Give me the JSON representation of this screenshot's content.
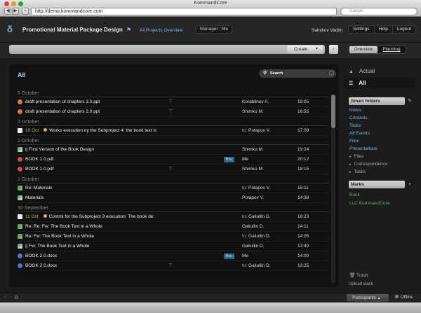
{
  "window": {
    "title": "KommandCore",
    "url": "http://demo.kommandcore.com",
    "google_placeholder": "Google"
  },
  "header": {
    "project_title": "Promotional Material Package Design",
    "all_projects": "All Projects Overview",
    "manager_label": "Manager : Me",
    "user": "Salnikov Vadim",
    "menu": [
      "Settings",
      "Help",
      "Logout"
    ]
  },
  "toolbar": {
    "create_label": "Create",
    "views": [
      "Overview",
      "Planning"
    ]
  },
  "main": {
    "title": "All",
    "search_label": "Search",
    "groups": [
      {
        "date": "5 October",
        "rows": [
          {
            "icon": "ppt",
            "title": "draft presentation of chapters 3.0.ppt",
            "pin": true,
            "tag": "",
            "to": false,
            "who": "Korablinov A.",
            "time": "19:05"
          },
          {
            "icon": "ppt",
            "title": "draft presentation of chapters 2.0.ppt",
            "pin": true,
            "tag": "",
            "to": false,
            "who": "Shimko M.",
            "time": "16:55"
          }
        ]
      },
      {
        "date": "3 October",
        "rows": [
          {
            "icon": "chk",
            "task_date": "10 Oct",
            "title": "Works execution ny the Subproject 4: the book text is",
            "pin": false,
            "tag": "",
            "to": true,
            "who": "Potapov V.",
            "time": "17:09"
          }
        ]
      },
      {
        "date": "2 October",
        "rows": [
          {
            "icon": "mail2",
            "title": "|| First Version of the Book Design",
            "pin": false,
            "tag": "",
            "to": false,
            "who": "Shimko M.",
            "time": "19:24"
          },
          {
            "icon": "pdf",
            "title": "BOOK 1.0.pdf",
            "pin": false,
            "tag": "Box",
            "to": false,
            "who": "Me",
            "time": "20:12"
          },
          {
            "icon": "pdf",
            "title": "BOOK 1.0.pdf",
            "pin": true,
            "tag": "",
            "to": false,
            "who": "Shimko M.",
            "time": "18:15"
          }
        ]
      },
      {
        "date": "1 October",
        "rows": [
          {
            "icon": "mail",
            "title": "Re: Materials",
            "pin": false,
            "tag": "",
            "to": true,
            "who": "Potapov V.",
            "time": "15:11"
          },
          {
            "icon": "mail2",
            "title": "Materials",
            "pin": false,
            "tag": "",
            "to": false,
            "who": "Potapov V.",
            "time": "14:38"
          }
        ]
      },
      {
        "date": "30 September",
        "rows": [
          {
            "icon": "chk",
            "task_date": "11 Oct",
            "title": "Control for the Subproject 3 execution: The book de:",
            "pin": false,
            "tag": "",
            "to": true,
            "who": "Galiullin D.",
            "time": "16:23"
          },
          {
            "icon": "mail",
            "title": "Re: Re: Fw: The Book Text in a Whole",
            "pin": false,
            "tag": "",
            "to": false,
            "who": "Galiullin D.",
            "time": "14:11"
          },
          {
            "icon": "mail",
            "title": "Re: Fw: The Book Text in a Whole",
            "pin": false,
            "tag": "",
            "to": true,
            "who": "Galiullin D.",
            "time": "14:05"
          },
          {
            "icon": "mail2",
            "title": "|| Fw: The Book Text in a Whole",
            "pin": false,
            "tag": "",
            "to": false,
            "who": "Galiullin D.",
            "time": "13:40"
          },
          {
            "icon": "doc",
            "title": "BOOK 2.0.docx",
            "pin": false,
            "tag": "Box",
            "to": false,
            "who": "Me",
            "time": "14:00"
          },
          {
            "icon": "doc",
            "title": "BOOK 2.0.docx",
            "pin": true,
            "tag": "",
            "to": true,
            "who": "Galiullin D.",
            "time": "13:25"
          }
        ]
      }
    ],
    "to_label": "to:"
  },
  "sidebar": {
    "actual": "Actual",
    "all": "All",
    "smart_folders": "Smart folders",
    "smart_links": [
      "Notes",
      "Contacts",
      "Tasks",
      "All Events",
      "Files",
      "Presentations"
    ],
    "smart_sub": [
      "Files",
      "Correspondence",
      "Tasks"
    ],
    "marks": "Marks",
    "mark_links": [
      "Book",
      "LLC KommandCore"
    ],
    "trash": "Trash",
    "upload": "Upload stack"
  },
  "bottom": {
    "participants": "Participants",
    "offline": "Offline"
  },
  "colors": {
    "accent_blue": "#7ab8e8",
    "task_green": "#9cc94a",
    "mark_green": "#6aa86a",
    "tag_bg": "#2d6a8a"
  }
}
